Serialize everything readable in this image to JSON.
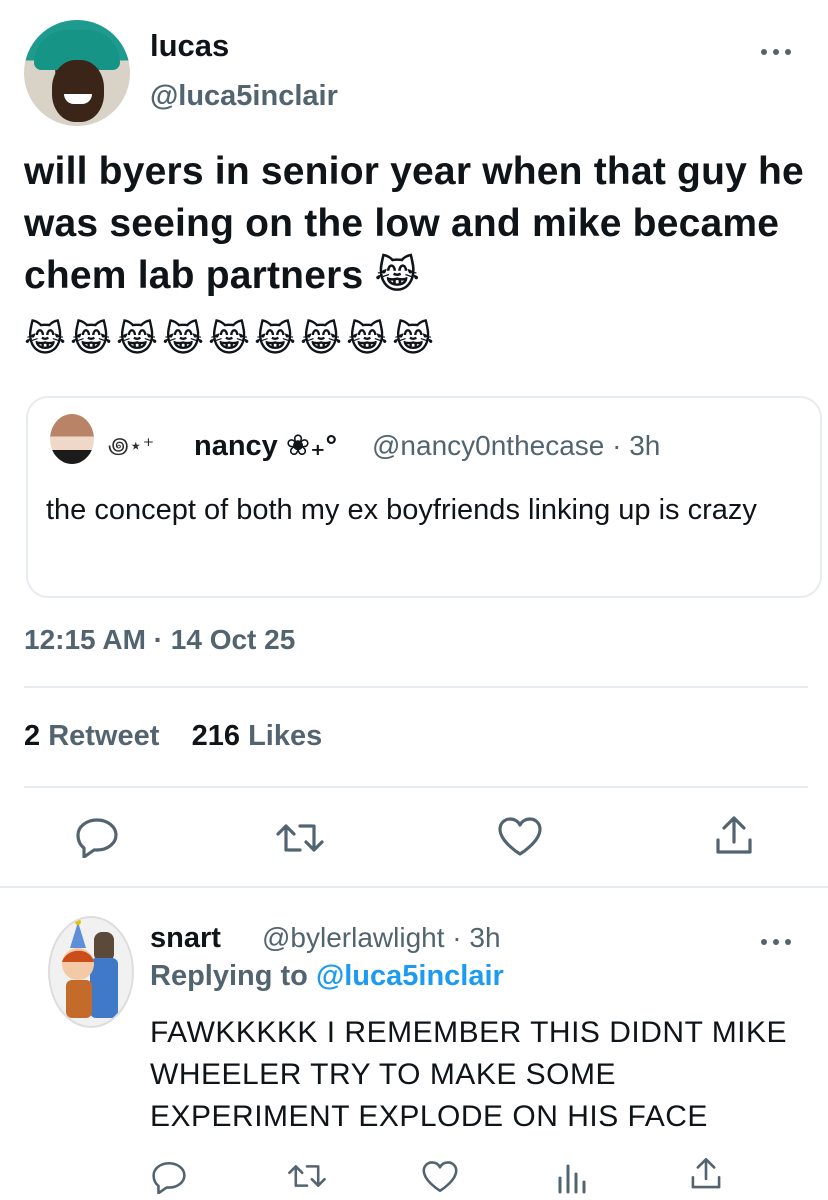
{
  "tweet": {
    "author_name": "lucas",
    "author_handle": "@luca5inclair",
    "text": "will byers in senior year  when that guy he was seeing on the low and mike became chem lab partners 😹",
    "emojis": [
      "😹",
      "😹",
      "😹",
      "😹",
      "😹",
      "😹",
      "😹",
      "😹",
      "😹"
    ],
    "timestamp": "12:15 AM · 14 Oct 25",
    "retweet_count": "2",
    "retweet_label": "Retweet",
    "likes_count": "216",
    "likes_label": "Likes"
  },
  "quoted_tweet": {
    "decoration": "꩜⋆⁺",
    "author_name": "nancy ❀₊°",
    "author_handle": "@nancy0nthecase · 3h",
    "text": "the concept of both my ex boyfriends linking up is crazy"
  },
  "reply": {
    "author_name": "snart",
    "author_handle": "@bylerlawlight · 3h",
    "replying_prefix": "Replying to",
    "replying_to": "@luca5inclair",
    "text": "FAWKKKKK I REMEMBER THIS DIDNT MIKE WHEELER TRY TO MAKE SOME EXPERIMENT EXPLODE ON HIS FACE"
  },
  "icons": {
    "reply": "reply-icon",
    "retweet": "retweet-icon",
    "like": "heart-icon",
    "share": "share-icon",
    "views": "views-icon",
    "more": "more-icon"
  },
  "colors": {
    "text": "#0f1419",
    "secondary": "#536471",
    "accent": "#1d9bf0",
    "divider": "#e6ecf0"
  }
}
